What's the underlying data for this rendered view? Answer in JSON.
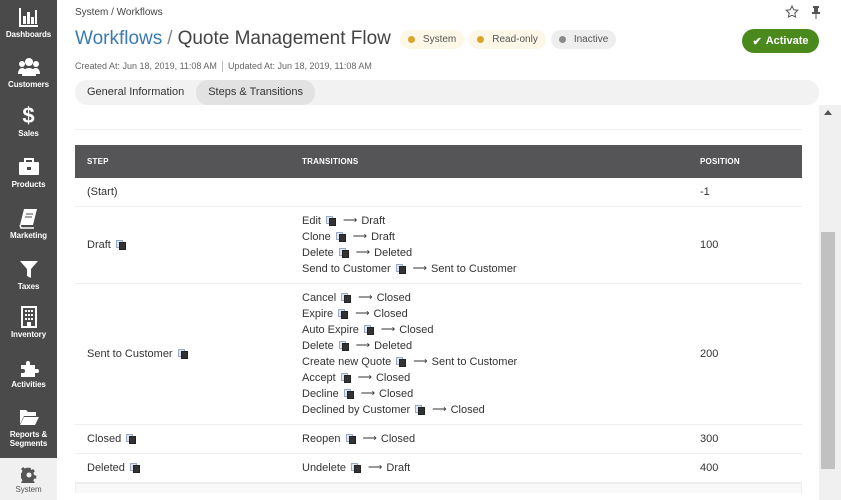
{
  "sidebar": {
    "items": [
      {
        "label": "Dashboards",
        "icon": "bar-chart-icon"
      },
      {
        "label": "Customers",
        "icon": "users-icon"
      },
      {
        "label": "Sales",
        "icon": "dollar-icon"
      },
      {
        "label": "Products",
        "icon": "briefcase-icon"
      },
      {
        "label": "Marketing",
        "icon": "book-icon"
      },
      {
        "label": "Taxes",
        "icon": "filter-icon"
      },
      {
        "label": "Inventory",
        "icon": "building-icon"
      },
      {
        "label": "Activities",
        "icon": "puzzle-icon"
      },
      {
        "label": "Reports &",
        "label2": "Segments",
        "icon": "folder-open-icon"
      },
      {
        "label": "System",
        "icon": "gear-icon",
        "active": true
      }
    ]
  },
  "header": {
    "breadcrumb": "System / Workflows",
    "title_link": "Workflows",
    "title_separator": "/",
    "title": "Quote Management Flow",
    "badges": [
      {
        "label": "System",
        "color": "#dba42a"
      },
      {
        "label": "Read-only",
        "color": "#dba42a"
      },
      {
        "label": "Inactive",
        "color": "#8a8a8a"
      }
    ],
    "created": "Created At: Jun 18, 2019, 11:08 AM",
    "updated": "Updated At: Jun 18, 2019, 11:08 AM",
    "activate_label": "Activate",
    "accent_color": "#4a8a1d"
  },
  "tabs": [
    {
      "label": "General Information",
      "active": false
    },
    {
      "label": "Steps & Transitions",
      "active": true
    }
  ],
  "table": {
    "columns": [
      "STEP",
      "TRANSITIONS",
      "POSITION"
    ],
    "rows": [
      {
        "step": "(Start)",
        "translatable": false,
        "position": "-1",
        "transitions": []
      },
      {
        "step": "Draft",
        "translatable": true,
        "position": "100",
        "transitions": [
          {
            "name": "Edit",
            "target": "Draft"
          },
          {
            "name": "Clone",
            "target": "Draft"
          },
          {
            "name": "Delete",
            "target": "Deleted"
          },
          {
            "name": "Send to Customer",
            "target": "Sent to Customer"
          }
        ]
      },
      {
        "step": "Sent to Customer",
        "translatable": true,
        "position": "200",
        "transitions": [
          {
            "name": "Cancel",
            "target": "Closed"
          },
          {
            "name": "Expire",
            "target": "Closed"
          },
          {
            "name": "Auto Expire",
            "target": "Closed"
          },
          {
            "name": "Delete",
            "target": "Deleted"
          },
          {
            "name": "Create new Quote",
            "target": "Sent to Customer"
          },
          {
            "name": "Accept",
            "target": "Closed"
          },
          {
            "name": "Decline",
            "target": "Closed"
          },
          {
            "name": "Declined by Customer",
            "target": "Closed"
          }
        ]
      },
      {
        "step": "Closed",
        "translatable": true,
        "position": "300",
        "transitions": [
          {
            "name": "Reopen",
            "target": "Closed"
          }
        ]
      },
      {
        "step": "Deleted",
        "translatable": true,
        "position": "400",
        "transitions": [
          {
            "name": "Undelete",
            "target": "Draft"
          }
        ]
      }
    ],
    "arrow_glyph": "⟶"
  }
}
